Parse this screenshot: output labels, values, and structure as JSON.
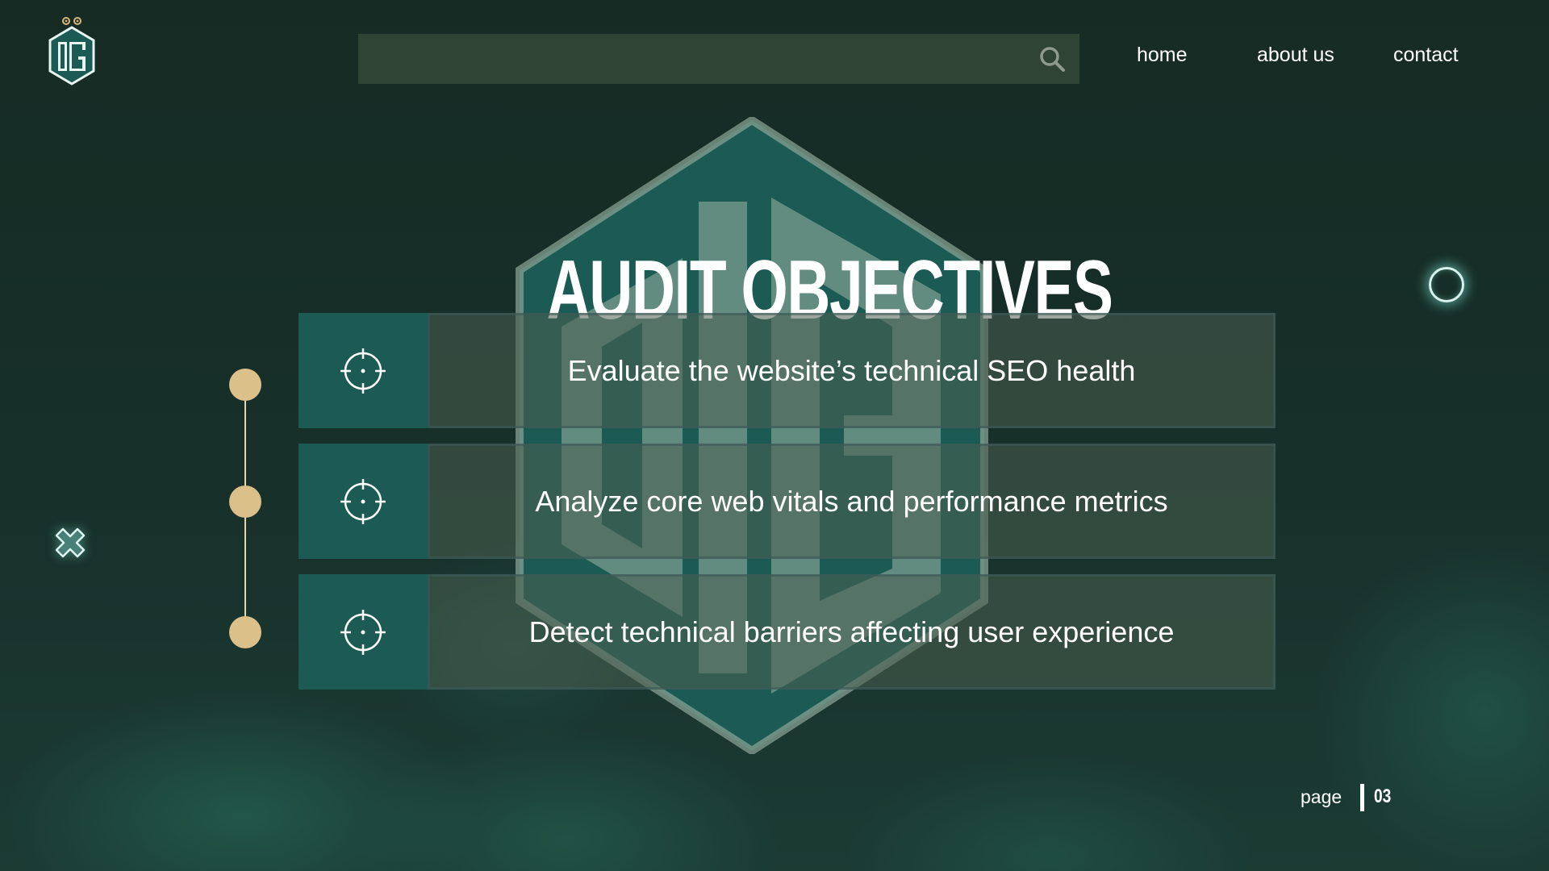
{
  "brand": {
    "logo_text": "OG",
    "logo_icon": "og-hexagon-logo"
  },
  "search": {
    "value": "",
    "placeholder": "",
    "icon": "search-icon"
  },
  "nav": {
    "home": "home",
    "about": "about us",
    "contact": "contact"
  },
  "main": {
    "title": "AUDIT OBJECTIVES",
    "objectives": [
      {
        "icon": "crosshair-icon",
        "text": "Evaluate the website’s technical SEO health"
      },
      {
        "icon": "crosshair-icon",
        "text": "Analyze core web vitals and performance metrics"
      },
      {
        "icon": "crosshair-icon",
        "text": "Detect technical barriers affecting user experience"
      }
    ]
  },
  "footer": {
    "page_label": "page",
    "page_number": "03"
  },
  "colors": {
    "background": "#16302a",
    "accent_teal": "#1b5b53",
    "timeline_gold": "#dcc08a",
    "search_bg": "#2f4434"
  }
}
